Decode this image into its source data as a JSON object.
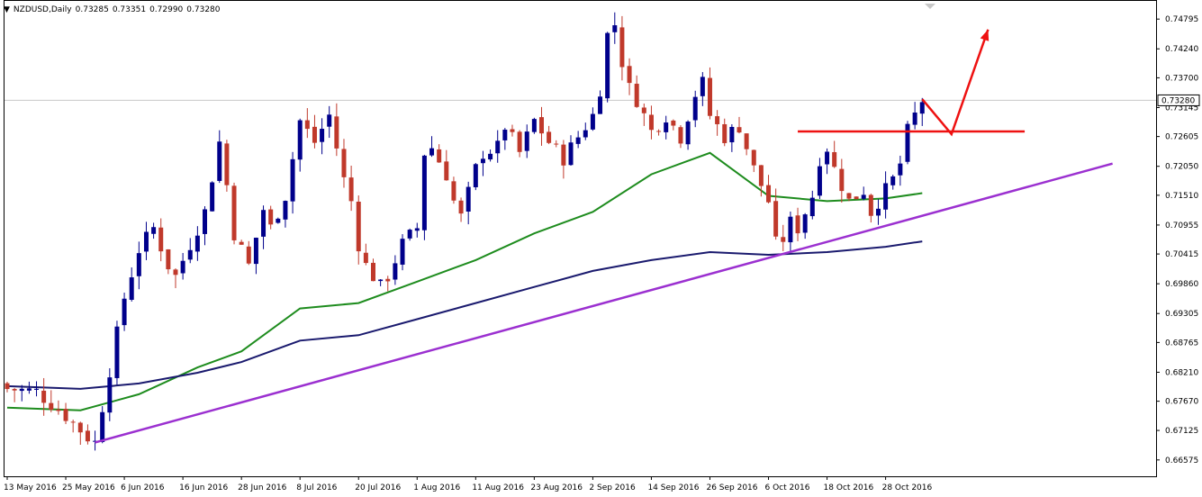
{
  "header": {
    "triangle_icon": "triangle-down-icon",
    "symbol_timeframe": "NZDUSD,Daily",
    "open": "0.73285",
    "high": "0.73351",
    "low": "0.72990",
    "close": "0.73280"
  },
  "chart_data": {
    "type": "candlestick",
    "symbol": "NZDUSD",
    "timeframe": "Daily",
    "ylim": [
      0.6627,
      0.7505
    ],
    "y_ticks": [
      "0.74795",
      "0.74240",
      "0.73700",
      "0.73145",
      "0.72605",
      "0.72050",
      "0.71510",
      "0.70955",
      "0.70415",
      "0.69860",
      "0.69305",
      "0.68765",
      "0.68210",
      "0.67670",
      "0.67125",
      "0.66575"
    ],
    "x_ticks": [
      {
        "label": "13 May 2016",
        "index": 0
      },
      {
        "label": "25 May 2016",
        "index": 8
      },
      {
        "label": "6 Jun 2016",
        "index": 16
      },
      {
        "label": "16 Jun 2016",
        "index": 24
      },
      {
        "label": "28 Jun 2016",
        "index": 32
      },
      {
        "label": "8 Jul 2016",
        "index": 40
      },
      {
        "label": "20 Jul 2016",
        "index": 48
      },
      {
        "label": "1 Aug 2016",
        "index": 56
      },
      {
        "label": "11 Aug 2016",
        "index": 64
      },
      {
        "label": "23 Aug 2016",
        "index": 72
      },
      {
        "label": "2 Sep 2016",
        "index": 80
      },
      {
        "label": "14 Sep 2016",
        "index": 88
      },
      {
        "label": "26 Sep 2016",
        "index": 96
      },
      {
        "label": "6 Oct 2016",
        "index": 104
      },
      {
        "label": "18 Oct 2016",
        "index": 112
      },
      {
        "label": "28 Oct 2016",
        "index": 120
      }
    ],
    "current_price": "0.73280",
    "colors": {
      "bull": "#00008b",
      "bear": "#c0392b",
      "ma_fast": "#1e8c1e",
      "ma_slow": "#1a1a6e",
      "trendline": "#9b30d0",
      "resistance": "#ee1111",
      "arrow": "#ee1111",
      "grid": "#c8c8c8",
      "frame": "#000000"
    },
    "candle_close_path": [
      [
        0,
        0.679
      ],
      [
        4,
        0.6785
      ],
      [
        8,
        0.674
      ],
      [
        11,
        0.67
      ],
      [
        12,
        0.669
      ],
      [
        14,
        0.6825
      ],
      [
        16,
        0.696
      ],
      [
        18,
        0.705
      ],
      [
        20,
        0.709
      ],
      [
        22,
        0.702
      ],
      [
        23,
        0.7
      ],
      [
        25,
        0.706
      ],
      [
        27,
        0.712
      ],
      [
        29,
        0.725
      ],
      [
        30,
        0.717
      ],
      [
        31,
        0.708
      ],
      [
        33,
        0.702
      ],
      [
        35,
        0.7125
      ],
      [
        36,
        0.709
      ],
      [
        38,
        0.715
      ],
      [
        40,
        0.729
      ],
      [
        42,
        0.725
      ],
      [
        44,
        0.73
      ],
      [
        45,
        0.724
      ],
      [
        46,
        0.718
      ],
      [
        47,
        0.714
      ],
      [
        48,
        0.706
      ],
      [
        49,
        0.702
      ],
      [
        50,
        0.7
      ],
      [
        51,
        0.698
      ],
      [
        52,
        0.7
      ],
      [
        54,
        0.706
      ],
      [
        56,
        0.709
      ],
      [
        57,
        0.723
      ],
      [
        58,
        0.724
      ],
      [
        60,
        0.719
      ],
      [
        61,
        0.714
      ],
      [
        62,
        0.711
      ],
      [
        64,
        0.72
      ],
      [
        65,
        0.723
      ],
      [
        67,
        0.724
      ],
      [
        68,
        0.728
      ],
      [
        70,
        0.723
      ],
      [
        72,
        0.729
      ],
      [
        74,
        0.725
      ],
      [
        76,
        0.722
      ],
      [
        78,
        0.726
      ],
      [
        80,
        0.73
      ],
      [
        81,
        0.735
      ],
      [
        82,
        0.745
      ],
      [
        83,
        0.747
      ],
      [
        84,
        0.74
      ],
      [
        85,
        0.735
      ],
      [
        86,
        0.733
      ],
      [
        88,
        0.727
      ],
      [
        90,
        0.73
      ],
      [
        92,
        0.726
      ],
      [
        94,
        0.734
      ],
      [
        95,
        0.736
      ],
      [
        96,
        0.73
      ],
      [
        98,
        0.726
      ],
      [
        100,
        0.728
      ],
      [
        101,
        0.724
      ],
      [
        102,
        0.72
      ],
      [
        103,
        0.717
      ],
      [
        104,
        0.714
      ],
      [
        105,
        0.706
      ],
      [
        106,
        0.707
      ],
      [
        107,
        0.71
      ],
      [
        108,
        0.709
      ],
      [
        110,
        0.715
      ],
      [
        111,
        0.722
      ],
      [
        112,
        0.724
      ],
      [
        113,
        0.72
      ],
      [
        114,
        0.717
      ],
      [
        115,
        0.714
      ],
      [
        117,
        0.716
      ],
      [
        118,
        0.712
      ],
      [
        120,
        0.716
      ],
      [
        121,
        0.718
      ],
      [
        122,
        0.721
      ],
      [
        123,
        0.727
      ],
      [
        124,
        0.73
      ],
      [
        125,
        0.7328
      ]
    ],
    "ma_fast_points": [
      [
        0,
        0.6755
      ],
      [
        10,
        0.675
      ],
      [
        18,
        0.678
      ],
      [
        26,
        0.683
      ],
      [
        32,
        0.686
      ],
      [
        40,
        0.694
      ],
      [
        48,
        0.695
      ],
      [
        56,
        0.699
      ],
      [
        64,
        0.703
      ],
      [
        72,
        0.708
      ],
      [
        80,
        0.712
      ],
      [
        88,
        0.719
      ],
      [
        96,
        0.723
      ],
      [
        104,
        0.715
      ],
      [
        112,
        0.714
      ],
      [
        120,
        0.7145
      ],
      [
        125,
        0.7155
      ]
    ],
    "ma_slow_points": [
      [
        0,
        0.6795
      ],
      [
        10,
        0.679
      ],
      [
        18,
        0.68
      ],
      [
        26,
        0.682
      ],
      [
        32,
        0.684
      ],
      [
        40,
        0.688
      ],
      [
        48,
        0.689
      ],
      [
        56,
        0.692
      ],
      [
        64,
        0.695
      ],
      [
        72,
        0.698
      ],
      [
        80,
        0.701
      ],
      [
        88,
        0.703
      ],
      [
        96,
        0.7045
      ],
      [
        104,
        0.704
      ],
      [
        112,
        0.7045
      ],
      [
        120,
        0.7055
      ],
      [
        125,
        0.7065
      ]
    ],
    "trendline": [
      [
        12,
        0.669
      ],
      [
        151,
        0.721
      ]
    ],
    "resistance": {
      "from": 108,
      "to": 139,
      "price": 0.727
    },
    "projection_arrow": [
      [
        125,
        0.733
      ],
      [
        129,
        0.7265
      ],
      [
        134,
        0.746
      ]
    ]
  }
}
